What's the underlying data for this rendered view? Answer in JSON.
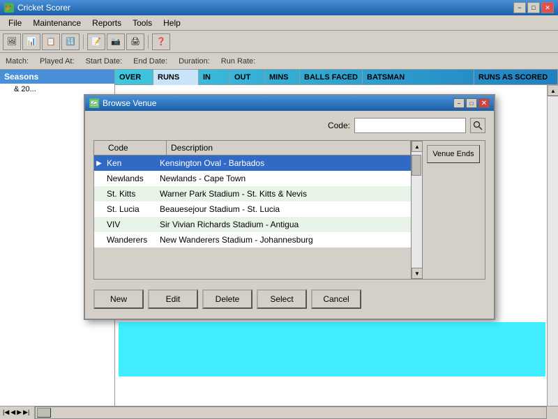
{
  "app": {
    "title": "Cricket Scorer",
    "icon": "🏏"
  },
  "title_bar": {
    "title": "Cricket Scorer",
    "minimize": "−",
    "maximize": "□",
    "close": "✕"
  },
  "menu": {
    "items": [
      "File",
      "Maintenance",
      "Reports",
      "Tools",
      "Help"
    ]
  },
  "toolbar": {
    "buttons": [
      "🖼",
      "📊",
      "📋",
      "🔢",
      "📝",
      "📷",
      "🖨",
      "❓"
    ]
  },
  "status_bar": {
    "match_label": "Match:",
    "played_at_label": "Played At:",
    "start_date_label": "Start Date:",
    "end_date_label": "End Date:",
    "duration_label": "Duration:",
    "run_rate_label": "Run Rate:"
  },
  "table_headers": {
    "over": "OVER",
    "runs": "RUNS",
    "in": "IN",
    "out": "OUT",
    "mins": "MINS",
    "balls_faced": "BALLS FACED",
    "batsman": "BATSMAN",
    "runs_as_scored": "RUNS AS SCORED"
  },
  "sidebar": {
    "header": "Seasons",
    "item": "& 20..."
  },
  "modal": {
    "title": "Browse Venue",
    "icon": "🗺",
    "code_label": "Code:",
    "code_value": "",
    "search_icon": "🔍",
    "table": {
      "headers": {
        "code": "Code",
        "description": "Description"
      },
      "rows": [
        {
          "code": "Ken",
          "description": "Kensington Oval - Barbados",
          "selected": true,
          "indicator": "▶"
        },
        {
          "code": "Newlands",
          "description": "Newlands - Cape Town",
          "selected": false
        },
        {
          "code": "St. Kitts",
          "description": "Warner Park Stadium - St. Kitts & Nevis",
          "selected": false,
          "alt": true
        },
        {
          "code": "St. Lucia",
          "description": "Beauesejour Stadium - St. Lucia",
          "selected": false
        },
        {
          "code": "VIV",
          "description": "Sir Vivian Richards Stadium - Antigua",
          "selected": false,
          "alt": true
        },
        {
          "code": "Wanderers",
          "description": "New Wanderers Stadium - Johannesburg",
          "selected": false
        }
      ]
    },
    "venue_ends_btn": "Venue Ends",
    "buttons": {
      "new": "New",
      "edit": "Edit",
      "delete": "Delete",
      "select": "Select",
      "cancel": "Cancel"
    }
  }
}
